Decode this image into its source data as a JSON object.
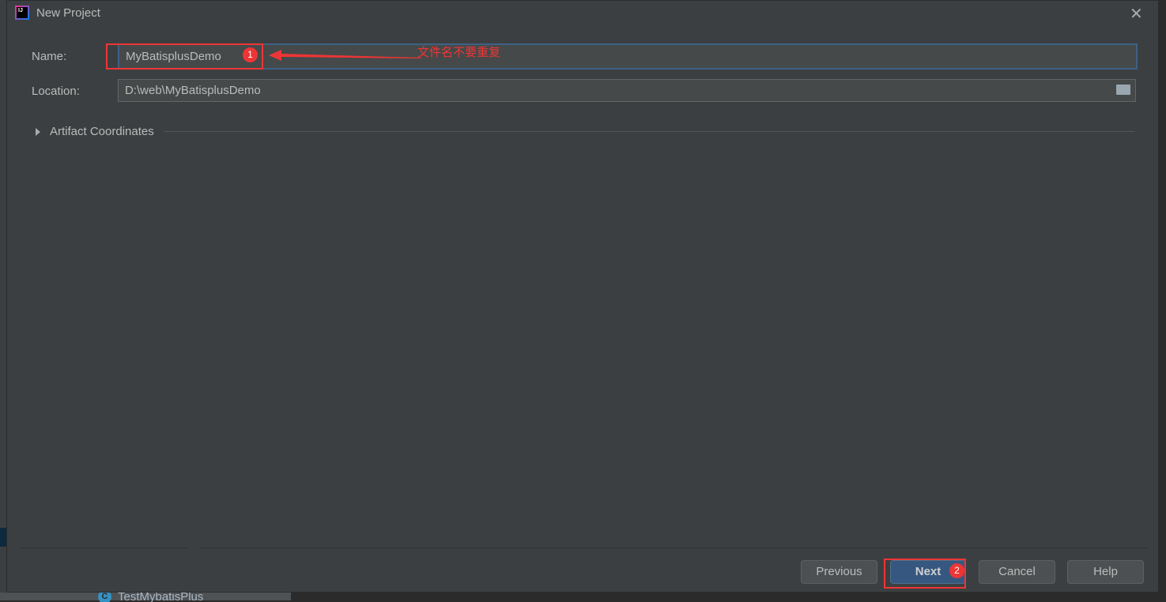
{
  "background": {
    "project_item": "TestMybatisPlus",
    "class_icon_letter": "C"
  },
  "dialog": {
    "title": "New Project",
    "name_label": "Name:",
    "name_value": "MyBatisplusDemo",
    "location_label": "Location:",
    "location_value": "D:\\web\\MyBatisplusDemo",
    "artifact_section": "Artifact Coordinates",
    "buttons": {
      "previous": "Previous",
      "next": "Next",
      "cancel": "Cancel",
      "help": "Help"
    }
  },
  "annotations": {
    "badge1": "1",
    "badge2": "2",
    "note": "文件名不要重复",
    "color": "#ee3535"
  },
  "colors": {
    "dialog_bg": "#3c3f41",
    "primary_button": "#365880",
    "focus_border": "#3d6185"
  }
}
